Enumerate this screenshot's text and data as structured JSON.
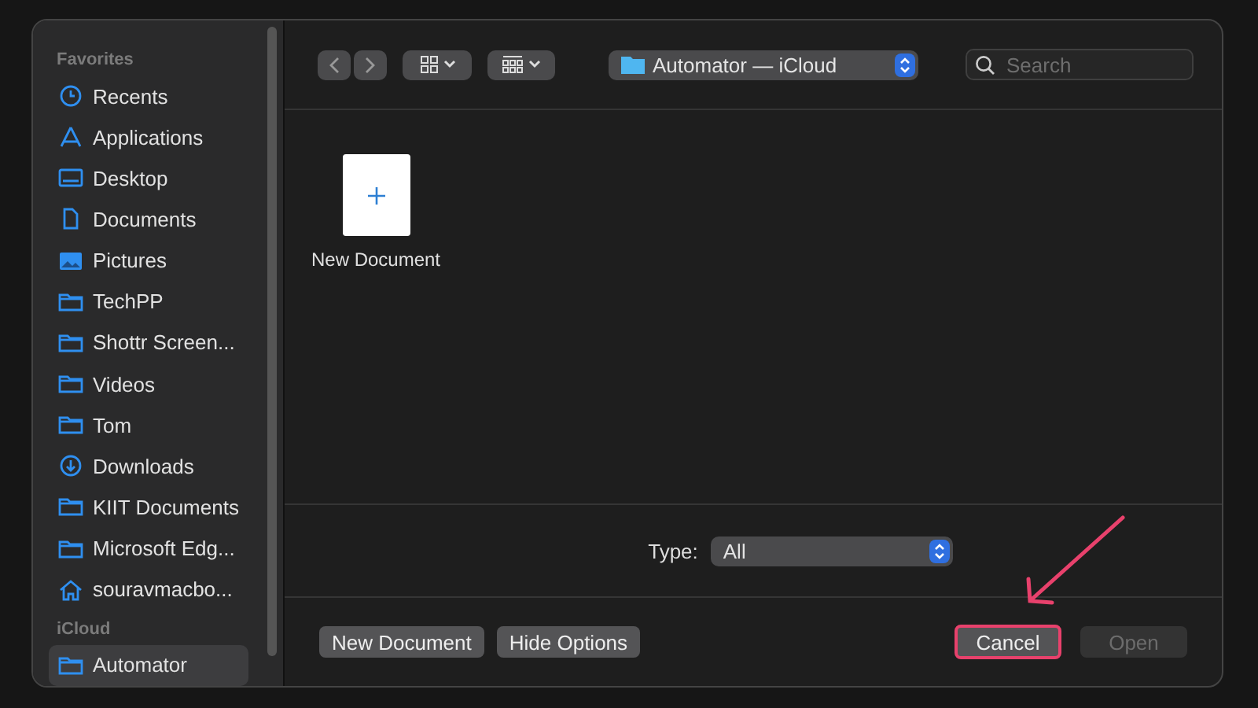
{
  "sidebar": {
    "sections": [
      {
        "title": "Favorites",
        "items": [
          {
            "label": "Recents",
            "kind": "clock",
            "selected": false
          },
          {
            "label": "Applications",
            "kind": "apps",
            "selected": false
          },
          {
            "label": "Desktop",
            "kind": "desktop",
            "selected": false
          },
          {
            "label": "Documents",
            "kind": "document",
            "selected": false
          },
          {
            "label": "Pictures",
            "kind": "picture",
            "selected": false
          },
          {
            "label": "TechPP",
            "kind": "folder",
            "selected": false
          },
          {
            "label": "Shottr Screen...",
            "kind": "folder",
            "selected": false
          },
          {
            "label": "Videos",
            "kind": "folder",
            "selected": false
          },
          {
            "label": "Tom",
            "kind": "folder",
            "selected": false
          },
          {
            "label": "Downloads",
            "kind": "download",
            "selected": false
          },
          {
            "label": "KIIT Documents",
            "kind": "folder",
            "selected": false
          },
          {
            "label": "Microsoft Edg...",
            "kind": "folder",
            "selected": false
          },
          {
            "label": "souravmacbo...",
            "kind": "home",
            "selected": false
          }
        ]
      },
      {
        "title": "iCloud",
        "items": [
          {
            "label": "Automator",
            "kind": "folder",
            "selected": true
          }
        ]
      }
    ]
  },
  "toolbar": {
    "location": "Automator — iCloud",
    "search": {
      "placeholder": "Search"
    }
  },
  "files": [
    {
      "name": "New Document"
    }
  ],
  "options": {
    "type_label": "Type:",
    "type_value": "All"
  },
  "buttons": [
    {
      "label": "New Document",
      "kind": "option",
      "disabled": false,
      "highlighted": false
    },
    {
      "label": "Hide Options",
      "kind": "option",
      "disabled": false,
      "highlighted": false
    },
    {
      "label": "Cancel",
      "kind": "action",
      "disabled": false,
      "highlighted": true
    },
    {
      "label": "Open",
      "kind": "action",
      "disabled": true,
      "highlighted": false
    }
  ]
}
